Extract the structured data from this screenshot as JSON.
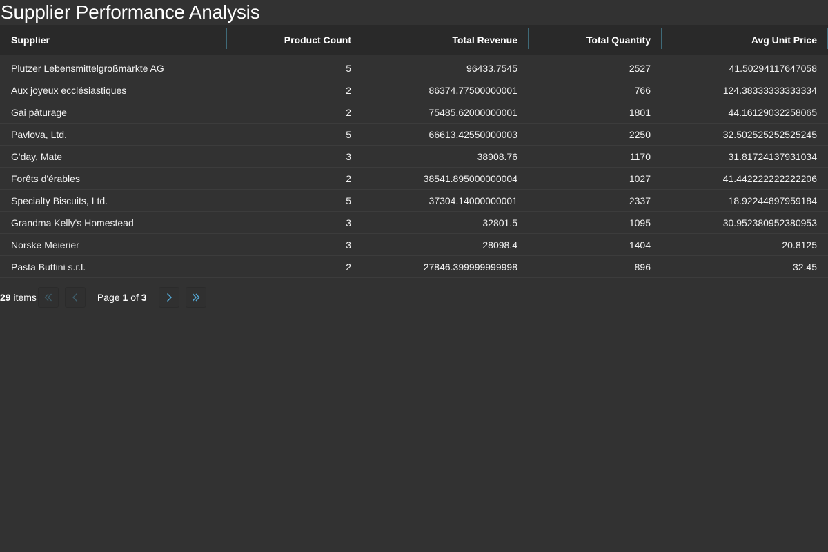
{
  "title": "Supplier Performance Analysis",
  "columns": [
    {
      "label": "Supplier"
    },
    {
      "label": "Product Count"
    },
    {
      "label": "Total Revenue"
    },
    {
      "label": "Total Quantity"
    },
    {
      "label": "Avg Unit Price"
    }
  ],
  "rows": [
    {
      "supplier": "Plutzer Lebensmittelgroßmärkte AG",
      "product_count": "5",
      "total_revenue": "96433.7545",
      "total_quantity": "2527",
      "avg_unit_price": "41.50294117647058"
    },
    {
      "supplier": "Aux joyeux ecclésiastiques",
      "product_count": "2",
      "total_revenue": "86374.77500000001",
      "total_quantity": "766",
      "avg_unit_price": "124.38333333333334"
    },
    {
      "supplier": "Gai pâturage",
      "product_count": "2",
      "total_revenue": "75485.62000000001",
      "total_quantity": "1801",
      "avg_unit_price": "44.16129032258065"
    },
    {
      "supplier": "Pavlova, Ltd.",
      "product_count": "5",
      "total_revenue": "66613.42550000003",
      "total_quantity": "2250",
      "avg_unit_price": "32.502525252525245"
    },
    {
      "supplier": "G'day, Mate",
      "product_count": "3",
      "total_revenue": "38908.76",
      "total_quantity": "1170",
      "avg_unit_price": "31.81724137931034"
    },
    {
      "supplier": "Forêts d'érables",
      "product_count": "2",
      "total_revenue": "38541.895000000004",
      "total_quantity": "1027",
      "avg_unit_price": "41.442222222222206"
    },
    {
      "supplier": "Specialty Biscuits, Ltd.",
      "product_count": "5",
      "total_revenue": "37304.14000000001",
      "total_quantity": "2337",
      "avg_unit_price": "18.92244897959184"
    },
    {
      "supplier": "Grandma Kelly's Homestead",
      "product_count": "3",
      "total_revenue": "32801.5",
      "total_quantity": "1095",
      "avg_unit_price": "30.952380952380953"
    },
    {
      "supplier": "Norske Meierier",
      "product_count": "3",
      "total_revenue": "28098.4",
      "total_quantity": "1404",
      "avg_unit_price": "20.8125"
    },
    {
      "supplier": "Pasta Buttini s.r.l.",
      "product_count": "2",
      "total_revenue": "27846.399999999998",
      "total_quantity": "896",
      "avg_unit_price": "32.45"
    }
  ],
  "pager": {
    "total_items": "29",
    "items_label": "items",
    "page_prefix": "Page",
    "current_page": "1",
    "of_label": "of",
    "total_pages": "3",
    "first_icon": "double-chevron-left-icon",
    "prev_icon": "chevron-left-icon",
    "next_icon": "chevron-right-icon",
    "last_icon": "double-chevron-right-icon"
  },
  "colors": {
    "background": "#323232",
    "header_background": "#292929",
    "column_separator": "#3f6a78",
    "pager_active": "#55a9d6",
    "pager_disabled": "#3f5f6d"
  }
}
